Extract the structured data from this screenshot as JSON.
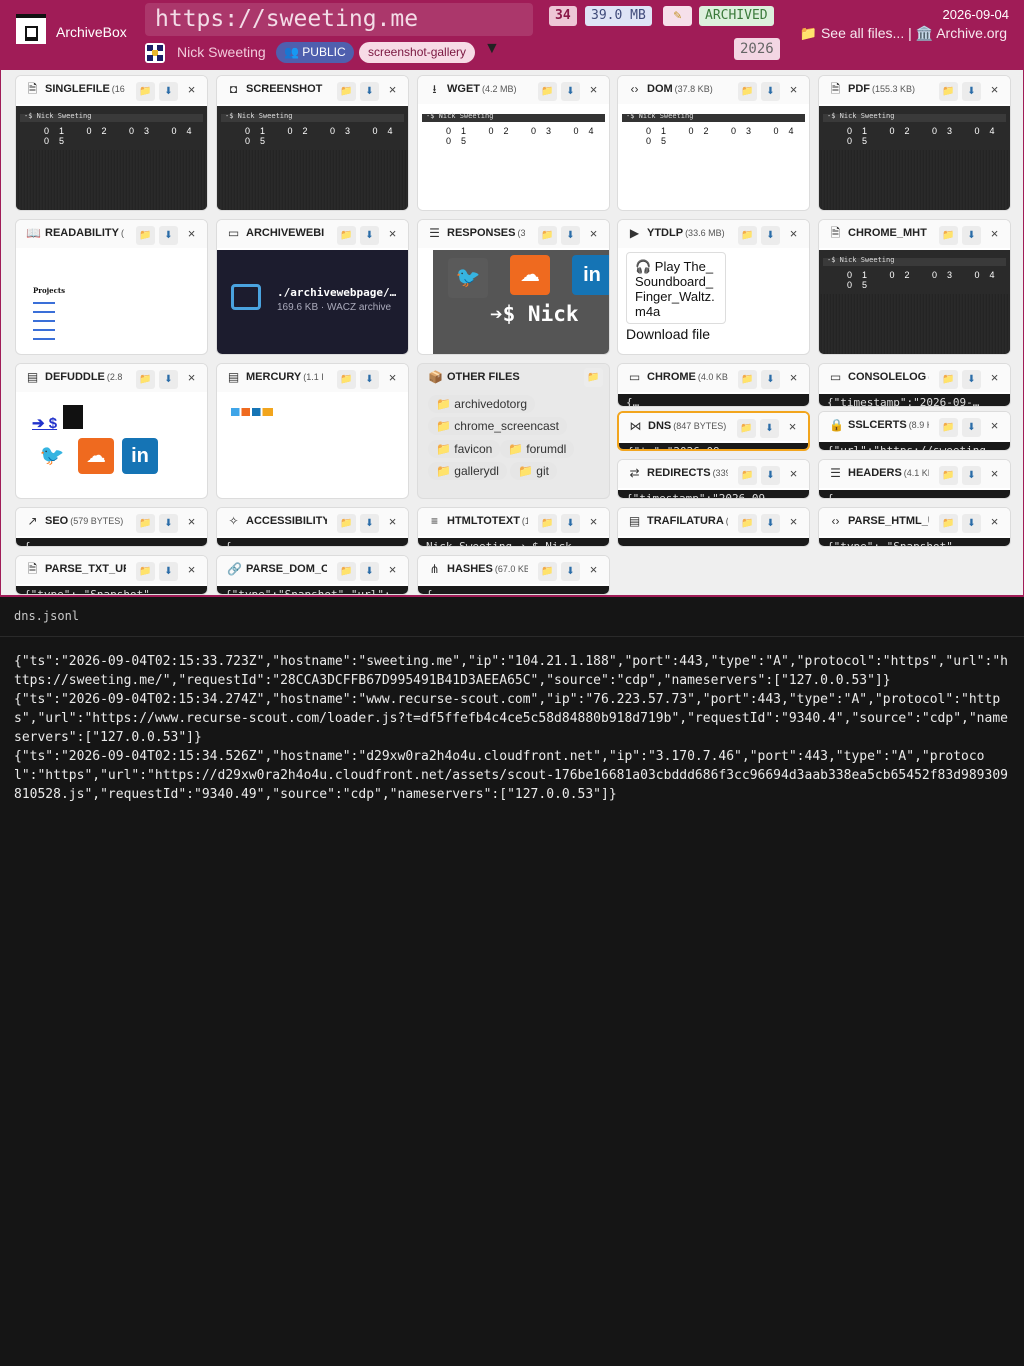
{
  "header": {
    "brand": "ArchiveBox",
    "url": "https://sweeting.me",
    "file_count": "34",
    "total_size": "39.0 MB",
    "edit_icon": "pencil-icon",
    "status": "ARCHIVED",
    "author": "Nick Sweeting",
    "visibility": "👥 PUBLIC",
    "tag": "screenshot-gallery",
    "more": "▼",
    "date": "2026-09-04",
    "year": "2026",
    "see_all": "📁 See all files...",
    "separator": "|",
    "archive_org": "🏛️ Archive.org"
  },
  "cards": [
    {
      "title": "SINGLEFILE",
      "size": "(16",
      "icon": "file-check-icon"
    },
    {
      "title": "SCREENSHOT",
      "size": "",
      "icon": "camera-icon"
    },
    {
      "title": "WGET",
      "size": "(4.2 MB)",
      "icon": "download-icon"
    },
    {
      "title": "DOM",
      "size": "(37.8 KB)",
      "icon": "code-icon"
    },
    {
      "title": "PDF",
      "size": "(155.3 KB)",
      "icon": "pdf-file-icon"
    },
    {
      "title": "READABILITY",
      "size": "(",
      "icon": "book-icon"
    },
    {
      "title": "ARCHIVEWEBI",
      "size": "",
      "icon": "archive-box-icon"
    },
    {
      "title": "RESPONSES",
      "size": "(3",
      "icon": "server-icon"
    },
    {
      "title": "YTDLP",
      "size": "(33.6 MB)",
      "icon": "video-icon"
    },
    {
      "title": "CHROME_MHT",
      "size": "",
      "icon": "document-icon"
    },
    {
      "title": "DEFUDDLE",
      "size": "(2.8",
      "icon": "newspaper-icon"
    },
    {
      "title": "MERCURY",
      "size": "(1.1 I",
      "icon": "article-icon"
    },
    {
      "title": "CHROME",
      "size": "(4.0 KB)",
      "icon": "browser-icon"
    },
    {
      "title": "CONSOLELOG",
      "size": "(3.",
      "icon": "terminal-icon"
    },
    {
      "title": "DNS",
      "size": "(847 BYTES)",
      "icon": "share-nodes-icon"
    },
    {
      "title": "SSLCERTS",
      "size": "(8.9 KB)",
      "icon": "lock-icon"
    },
    {
      "title": "REDIRECTS",
      "size": "(339 B",
      "icon": "arrows-icon"
    },
    {
      "title": "HEADERS",
      "size": "(4.1 KB)",
      "icon": "list-icon"
    },
    {
      "title": "SEO",
      "size": "(579 BYTES)",
      "icon": "trend-icon"
    },
    {
      "title": "ACCESSIBILITY",
      "size": "(4",
      "icon": "accessibility-icon"
    },
    {
      "title": "HTMLTOTEXT",
      "size": "(1.2",
      "icon": "text-lines-icon"
    },
    {
      "title": "TRAFILATURA",
      "size": "(4.6",
      "icon": "text-box-icon"
    },
    {
      "title": "PARSE_HTML_UR",
      "size": "",
      "icon": "code-icon"
    },
    {
      "title": "PARSE_TXT_URL",
      "size": "",
      "icon": "file-text-icon"
    },
    {
      "title": "PARSE_DOM_OUT",
      "size": "",
      "icon": "link-icon"
    },
    {
      "title": "HASHES",
      "size": "(67.0 KB)",
      "icon": "tree-icon"
    }
  ],
  "previews": {
    "site_name": "-$ Nick Sweeting",
    "nav_numbers": "01 02 03 04 05",
    "archivewebpage_file": "./archivewebpage/…",
    "archivewebpage_meta": "169.6 KB · WACZ archive",
    "ytdlp_play": "🎧 Play The_Soundboard_Finger_Waltz.m4a",
    "ytdlp_download": "Download file",
    "readability_heading": "Projects",
    "defuddle_link": "➔ $",
    "responses_prompt": "➔$ Nick",
    "chrome_pre": "{…",
    "consolelog_pre": "{\"timestamp\":\"2026-09-…",
    "dns_pre": "{\"ts\":\"2026-09…",
    "sslcerts_pre": "{\"url\":\"https://sweeting…",
    "redirects_pre": "{\"timestamp\":\"2026-09-…",
    "headers_pre": "{…",
    "seo_pre": "{…",
    "accessibility_pre": "{…",
    "htmltotext_pre": "Nick Sweeting ➔ $ Nick …",
    "trafilatura_pre": "---…",
    "parsehtml_pre": "{\"type\": \"Snapshot\", …",
    "parsetxt_pre": "{\"type\": \"Snapshot\", …",
    "parsedom_pre": "{\"type\":\"Snapshot\",\"url\":…",
    "hashes_pre": "{…"
  },
  "other_files": {
    "title": "OTHER FILES",
    "icon": "package-icon",
    "items": [
      "archivedotorg",
      "chrome_screencast",
      "favicon",
      "forumdl",
      "gallerydl",
      "git"
    ]
  },
  "dns_file": {
    "name": "dns.jsonl",
    "content": "{\"ts\":\"2026-09-04T02:15:33.723Z\",\"hostname\":\"sweeting.me\",\"ip\":\"104.21.1.188\",\"port\":443,\"type\":\"A\",\"protocol\":\"https\",\"url\":\"https://sweeting.me/\",\"requestId\":\"28CCA3DCFFB67D995491B41D3AEEA65C\",\"source\":\"cdp\",\"nameservers\":[\"127.0.0.53\"]}\n{\"ts\":\"2026-09-04T02:15:34.274Z\",\"hostname\":\"www.recurse-scout.com\",\"ip\":\"76.223.57.73\",\"port\":443,\"type\":\"A\",\"protocol\":\"https\",\"url\":\"https://www.recurse-scout.com/loader.js?t=df5ffefb4c4ce5c58d84880b918d719b\",\"requestId\":\"9340.4\",\"source\":\"cdp\",\"nameservers\":[\"127.0.0.53\"]}\n{\"ts\":\"2026-09-04T02:15:34.526Z\",\"hostname\":\"d29xw0ra2h4o4u.cloudfront.net\",\"ip\":\"3.170.7.46\",\"port\":443,\"type\":\"A\",\"protocol\":\"https\",\"url\":\"https://d29xw0ra2h4o4u.cloudfront.net/assets/scout-176be16681a03cbddd686f3cc96694d3aab338ea5cb65452f83d989309810528.js\",\"requestId\":\"9340.49\",\"source\":\"cdp\",\"nameservers\":[\"127.0.0.53\"]}"
  },
  "colors": {
    "accent": "#a01c57",
    "selected_border": "#f2a51d",
    "status_green": "#3b7a3b"
  }
}
